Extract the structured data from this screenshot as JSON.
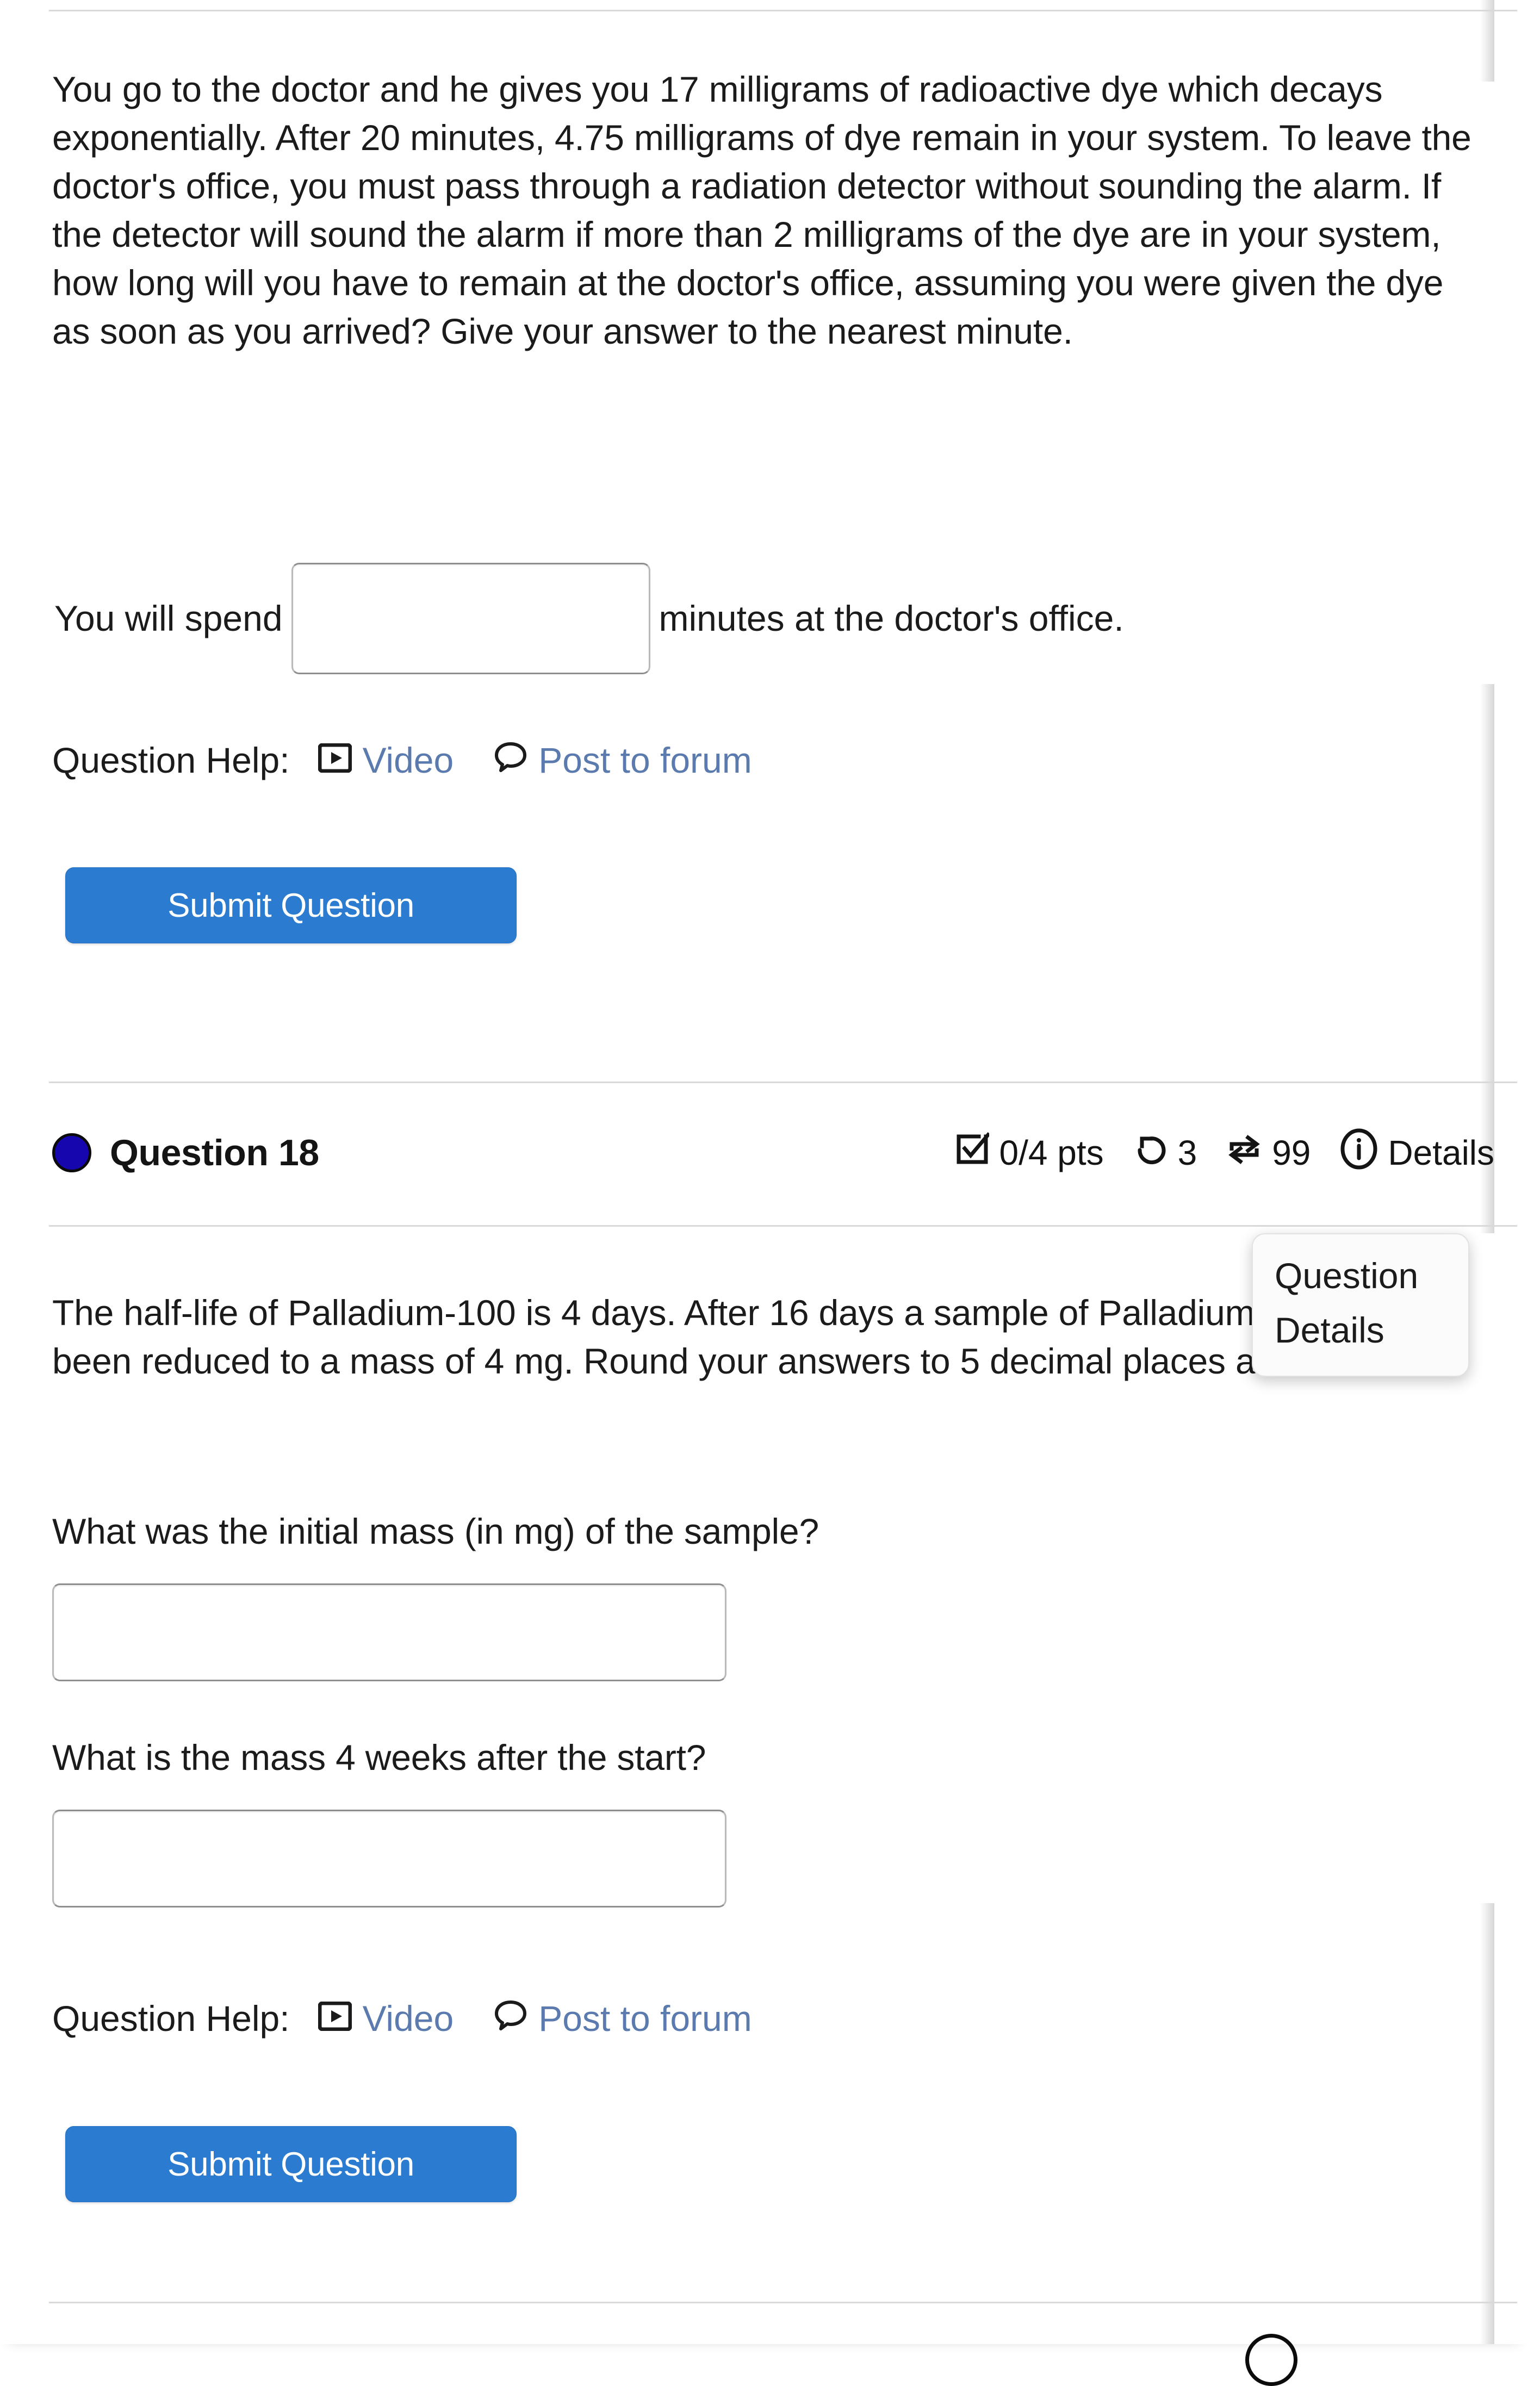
{
  "question_17": {
    "body": "You go to the doctor and he gives you 17 milligrams of radioactive dye which decays exponentially. After 20 minutes, 4.75 milligrams of dye remain in your system. To leave the doctor's office, you must pass through a radiation detector without sounding the alarm. If the detector will sound the alarm if more than 2 milligrams of the dye are in your system, how long will you have to remain at the doctor's office, assuming you were given the dye as soon as you arrived? Give your answer to the nearest minute.",
    "answer_prefix": "You will spend",
    "answer_suffix": "minutes at the doctor's office.",
    "answer_value": "",
    "answer_placeholder": "",
    "help_label": "Question Help:",
    "help_video": "Video",
    "help_forum": "Post to forum",
    "submit_label": "Submit Question"
  },
  "question_18": {
    "title": "Question 18",
    "points": "0/4 pts",
    "attempts": "3",
    "versions": "99",
    "details_label": "Details",
    "body": "The half-life of Palladium-100 is 4 days. After 16 days a sample of Palladium-100 has been reduced to a mass of 4 mg. Round your answers to 5 decimal places as needed.",
    "parts": [
      {
        "prompt": "What was the initial mass (in mg) of the sample?",
        "value": "",
        "placeholder": ""
      },
      {
        "prompt": "What is the mass 4 weeks after the start?",
        "value": "",
        "placeholder": ""
      }
    ],
    "help_label": "Question Help:",
    "help_video": "Video",
    "help_forum": "Post to forum",
    "submit_label": "Submit Question"
  },
  "tooltip": {
    "line1": "Question",
    "line2": "Details"
  },
  "colors": {
    "primary_button": "#2b7bd0",
    "link": "#5b7aad",
    "question_dot": "#1606ae",
    "divider": "#d9d9d9"
  },
  "icons": {
    "video": "video-icon",
    "forum": "forum-icon",
    "points": "checkbox-checked-icon",
    "attempts": "undo-history-icon",
    "versions": "shuffle-versions-icon",
    "details": "info-circle-icon"
  }
}
